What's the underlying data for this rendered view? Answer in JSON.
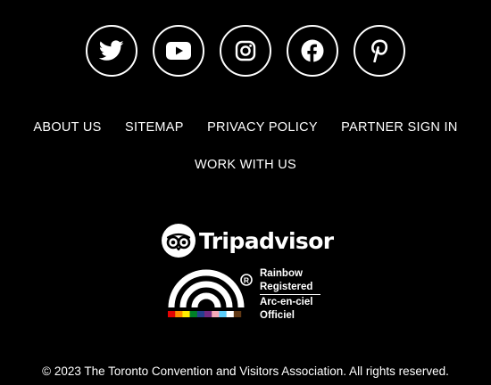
{
  "social": [
    {
      "name": "Twitter",
      "icon": "twitter-icon"
    },
    {
      "name": "YouTube",
      "icon": "youtube-icon"
    },
    {
      "name": "Instagram",
      "icon": "instagram-icon"
    },
    {
      "name": "Facebook",
      "icon": "facebook-icon"
    },
    {
      "name": "Pinterest",
      "icon": "pinterest-icon"
    }
  ],
  "nav": {
    "about": "ABOUT US",
    "sitemap": "SITEMAP",
    "privacy": "PRIVACY POLICY",
    "partner": "PARTNER SIGN IN",
    "work": "WORK WITH US"
  },
  "tripadvisor": {
    "wordmark": "Tripadvisor"
  },
  "rainbow": {
    "line1": "Rainbow",
    "line2": "Registered",
    "line3": "Arc-en-ciel",
    "line4": "Officiel",
    "mark": "R"
  },
  "copyright": "© 2023 The Toronto Convention and Visitors Association. All rights reserved.",
  "colors": {
    "background": "#000000",
    "foreground": "#ffffff",
    "stripe": [
      "#e40303",
      "#ff8c00",
      "#ffed00",
      "#008026",
      "#24408e",
      "#732982",
      "#f5a9b8",
      "#5bcefa",
      "#ffffff",
      "#613915"
    ]
  }
}
